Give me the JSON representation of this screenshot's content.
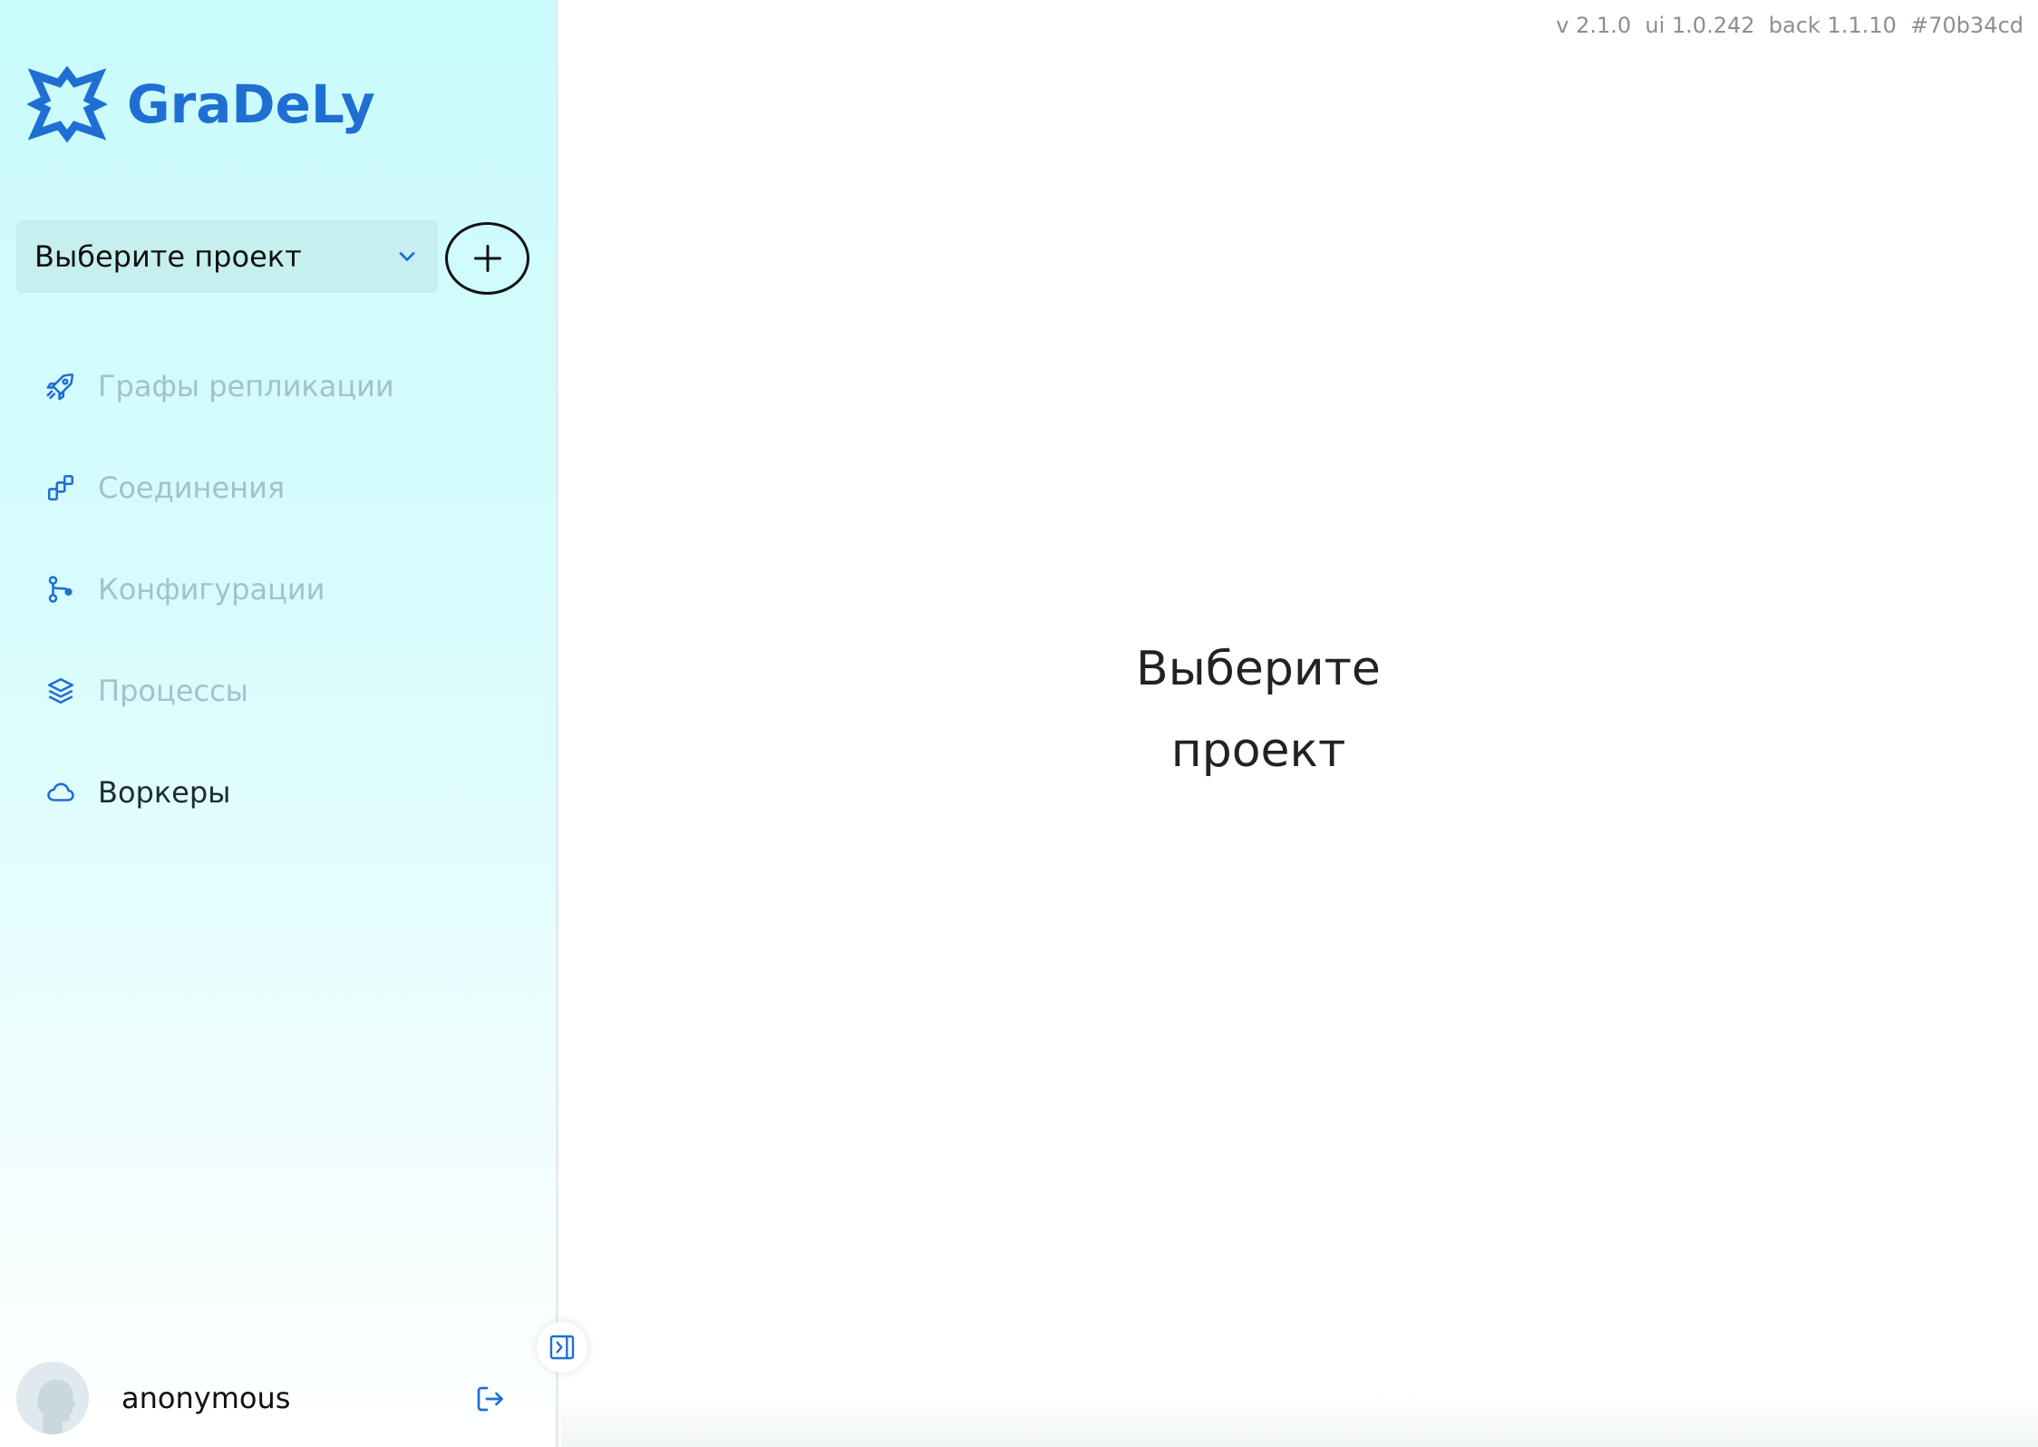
{
  "app": {
    "logo_text": "GraDeLy",
    "brand_color": "#1f6fd3"
  },
  "project_selector": {
    "placeholder": "Выберите проект",
    "icon": "chevron-down-icon",
    "add_icon": "plus-icon"
  },
  "nav": {
    "items": [
      {
        "label": "Графы репликации",
        "icon": "rocket-icon",
        "active": false
      },
      {
        "label": "Соединения",
        "icon": "connections-icon",
        "active": false
      },
      {
        "label": "Конфигурации",
        "icon": "git-branch-icon",
        "active": false
      },
      {
        "label": "Процессы",
        "icon": "layers-icon",
        "active": false
      },
      {
        "label": "Воркеры",
        "icon": "cloud-icon",
        "active": true
      }
    ]
  },
  "user": {
    "name": "anonymous",
    "avatar_icon": "avatar-silhouette-icon",
    "logout_icon": "logout-icon"
  },
  "sidebar_toggle_icon": "sidebar-collapse-icon",
  "version": "v 2.1.0  ui 1.0.242  back 1.1.10  #70b34cd",
  "main": {
    "empty_line1": "Выберите",
    "empty_line2": "проект"
  },
  "colors": {
    "inactive_text": "#a4c1c8",
    "active_text": "#1c2b34",
    "icon_blue": "#1f6fd3"
  }
}
